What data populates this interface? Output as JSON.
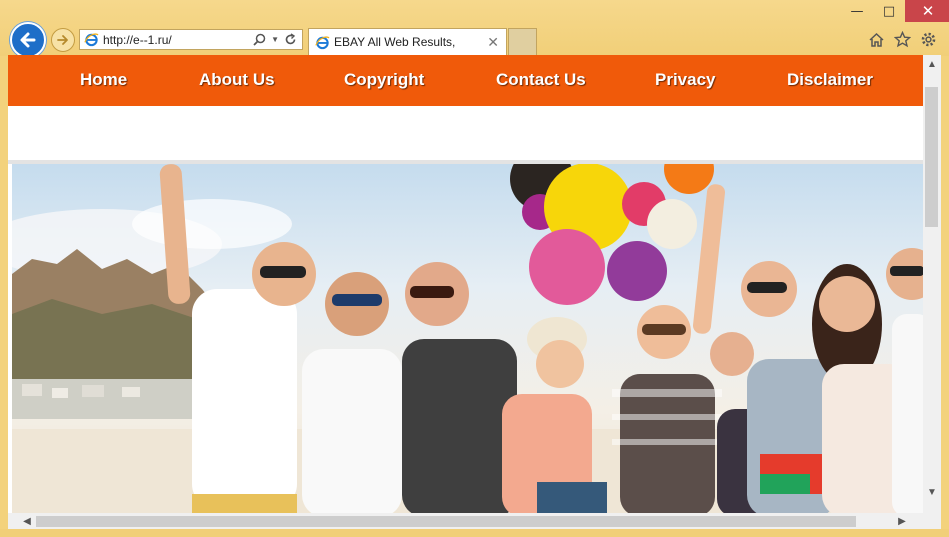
{
  "browser": {
    "address_url": "http://e--1.ru/",
    "tab_title": "EBAY All Web Results,",
    "window_controls": [
      "minimize",
      "maximize",
      "close"
    ],
    "right_icons": [
      "home-icon",
      "star-icon",
      "gear-icon"
    ],
    "accent_color": "#f1cf78"
  },
  "site": {
    "nav_color": "#f05a0a",
    "nav": [
      {
        "label": "Home"
      },
      {
        "label": "About Us"
      },
      {
        "label": "Copyright"
      },
      {
        "label": "Contact Us"
      },
      {
        "label": "Privacy"
      },
      {
        "label": "Disclaimer"
      }
    ],
    "hero": {
      "subject": "group-of-friends-with-balloons-photo"
    }
  }
}
